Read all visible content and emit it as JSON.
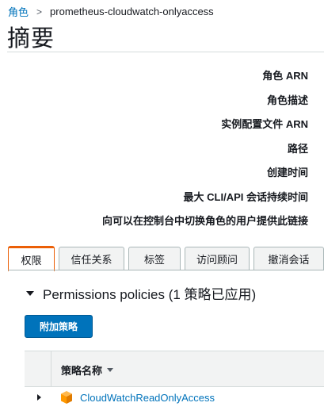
{
  "breadcrumb": {
    "parent": "角色",
    "separator": ">",
    "current": "prometheus-cloudwatch-onlyaccess"
  },
  "page": {
    "title": "摘要"
  },
  "summary": {
    "labels": [
      "角色 ARN",
      "角色描述",
      "实例配置文件 ARN",
      "路径",
      "创建时间",
      "最大 CLI/API 会话持续时间",
      "向可以在控制台中切换角色的用户提供此链接"
    ]
  },
  "tabs": [
    {
      "label": "权限",
      "active": true
    },
    {
      "label": "信任关系",
      "active": false
    },
    {
      "label": "标签",
      "active": false
    },
    {
      "label": "访问顾问",
      "active": false
    },
    {
      "label": "撤消会话",
      "active": false
    }
  ],
  "permissions": {
    "header": "Permissions policies (1 策略已应用)",
    "attach_button": "附加策略",
    "table": {
      "columns": [
        "策略名称"
      ],
      "rows": [
        {
          "policy_name": "CloudWatchReadOnlyAccess",
          "icon": "policy-cube-icon"
        }
      ]
    }
  },
  "colors": {
    "link": "#0073bb",
    "primary_button": "#0073bb",
    "active_tab_accent": "#eb5f07",
    "policy_icon": "#ff9900"
  }
}
